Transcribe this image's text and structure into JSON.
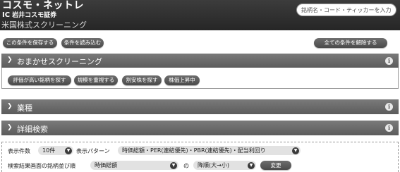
{
  "header": {
    "brand_main": "コスモ・ネットレ",
    "brand_mark": "IC",
    "brand_sub": "岩井コスモ証券",
    "page_title": "米国株式スクリーニング",
    "search_placeholder": "銘柄名・コード・ティッカーを入力"
  },
  "toolbar": {
    "save_condition": "この条件を保存する",
    "load_condition": "条件を読み込む",
    "clear_all": "全ての条件を解除する"
  },
  "panels": {
    "omakase": {
      "title": "おまかせスクリーニング",
      "buttons": [
        "評価が高い銘柄を探す",
        "規模を重視する",
        "割安株を探す",
        "株価上昇中"
      ]
    },
    "industry": {
      "title": "業種"
    },
    "detail": {
      "title": "詳細検索"
    }
  },
  "info_icon_glyph": "i",
  "options": {
    "display_count_label": "表示件数",
    "display_count_value": "10件",
    "display_pattern_label": "表示パターン",
    "display_pattern_value": "時価総額・PER(連結優先)・PBR(連結優先)・配当利回り",
    "sort_label": "検索結果画面の銘柄並び順",
    "sort_field_value": "時価総額",
    "sort_connector": "の",
    "sort_order_value": "降順(大→小)",
    "change_button": "変更"
  }
}
